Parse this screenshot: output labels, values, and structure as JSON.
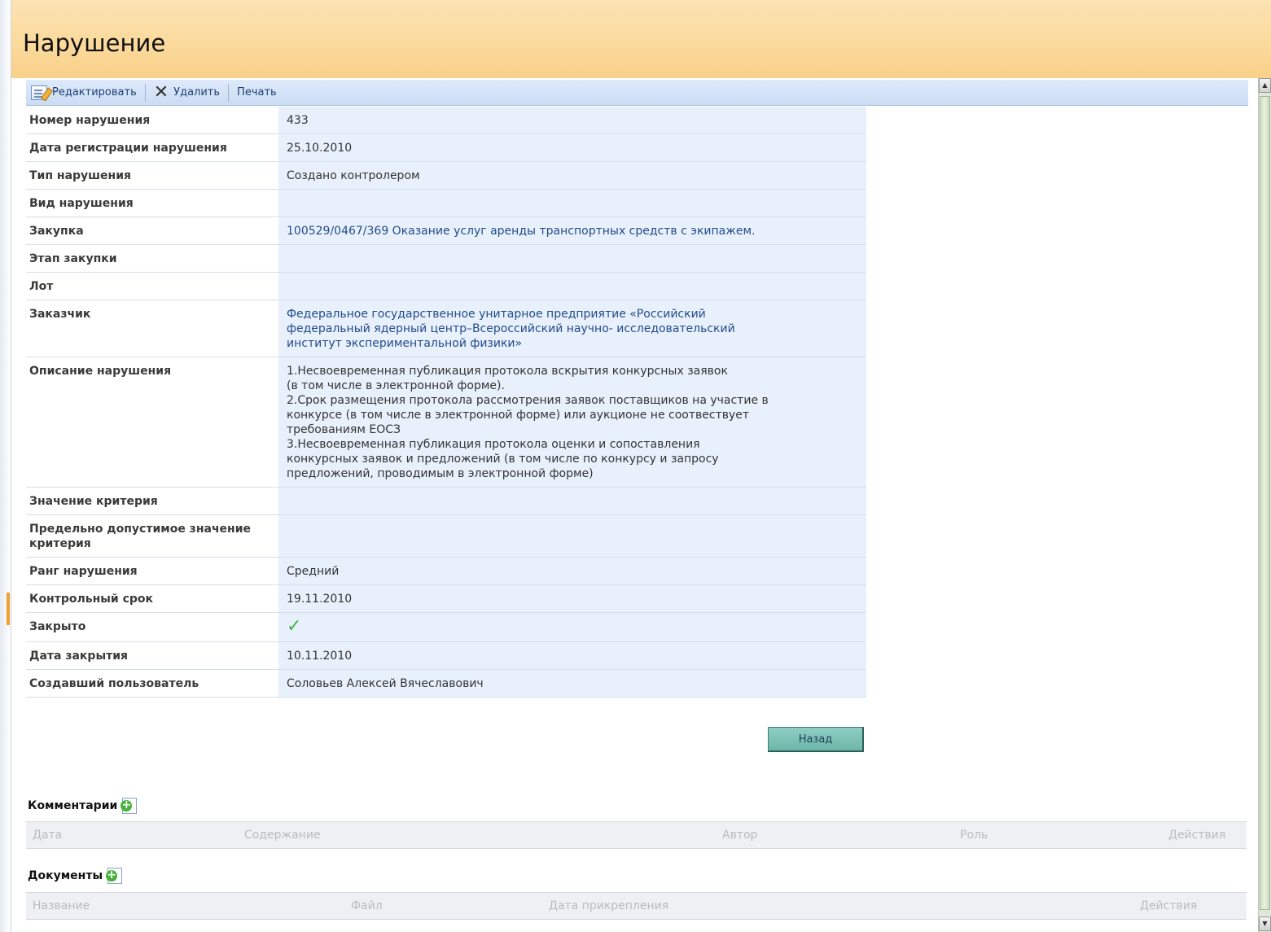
{
  "page": {
    "title": "Нарушение"
  },
  "toolbar": {
    "edit_label": "Редактировать",
    "delete_label": "Удалить",
    "print_label": "Печать"
  },
  "details": {
    "rows": [
      {
        "label": "Номер нарушения",
        "value": "433"
      },
      {
        "label": "Дата регистрации нарушения",
        "value": "25.10.2010"
      },
      {
        "label": "Тип нарушения",
        "value": "Создано контролером"
      },
      {
        "label": "Вид нарушения",
        "value": ""
      },
      {
        "label": "Закупка",
        "value": "100529/0467/369 Оказание услуг аренды транспортных средств с экипажем."
      },
      {
        "label": "Этап закупки",
        "value": ""
      },
      {
        "label": "Лот",
        "value": ""
      },
      {
        "label": "Заказчик",
        "lines": [
          "Федеральное государственное унитарное предприятие «Российский",
          "федеральный ядерный центр–Всероссийский научно- исследовательский",
          "институт экспериментальной физики»"
        ]
      },
      {
        "label": "Описание нарушения",
        "lines": [
          "1.Несвоевременная публикация протокола вскрытия конкурсных заявок",
          "(в том числе в электронной форме).",
          "2.Срок размещения протокола рассмотрения заявок поставщиков на участие в",
          "конкурсе (в том числе в электронной форме) или аукционе не соотвествует",
          "требованиям ЕОСЗ",
          "3.Несвоевременная публикация протокола оценки и сопоставления",
          "конкурсных заявок и предложений (в том числе по конкурсу и запросу",
          "предложений, проводимым в электронной форме)"
        ]
      },
      {
        "label": "Значение критерия",
        "value": ""
      },
      {
        "label": "Предельно допустимое значение критерия",
        "value": ""
      },
      {
        "label": "Ранг нарушения",
        "value": "Средний"
      },
      {
        "label": "Контрольный срок",
        "value": "19.11.2010"
      },
      {
        "label": "Закрыто",
        "icon": "checkmark-icon"
      },
      {
        "label": "Дата закрытия",
        "value": "10.11.2010"
      },
      {
        "label": "Создавший пользователь",
        "value": "Соловьев Алексей Вячеславович"
      }
    ]
  },
  "back_button": {
    "label": "Назад"
  },
  "comments": {
    "title": "Комментарии",
    "columns": [
      "Дата",
      "Содержание",
      "Автор",
      "Роль",
      "Действия"
    ]
  },
  "documents": {
    "title": "Документы",
    "columns": [
      "Название",
      "Файл",
      "Дата прикрепления",
      "Действия"
    ]
  },
  "colors": {
    "header_bg": "#fbd99a",
    "toolbar_bg": "#cbdcf3",
    "value_bg": "#e8f1fb",
    "link": "#224a8c",
    "check": "#3fb640",
    "back_button_bg": "#7fc1b6"
  }
}
